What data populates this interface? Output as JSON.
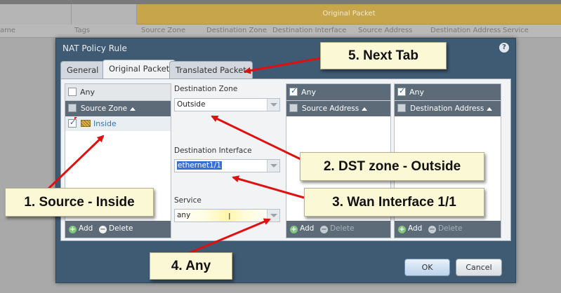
{
  "background": {
    "group_header": "Original Packet",
    "columns": [
      "ame",
      "Tags",
      "Source Zone",
      "Destination Zone",
      "Destination Interface",
      "Source Address",
      "Destination Address",
      "Service"
    ]
  },
  "dialog": {
    "title": "NAT Policy Rule",
    "help_icon": "?",
    "tabs": [
      {
        "label": "General",
        "active": false
      },
      {
        "label": "Original Packet",
        "active": true
      },
      {
        "label": "Translated Packet",
        "active": false
      }
    ],
    "source_zone_panel": {
      "any_label": "Any",
      "any_checked": false,
      "header": "Source Zone",
      "rows": [
        {
          "label": "Inside",
          "checked": true
        }
      ],
      "add_label": "Add",
      "delete_label": "Delete"
    },
    "destination_zone": {
      "label": "Destination Zone",
      "value": "Outside"
    },
    "destination_interface": {
      "label": "Destination Interface",
      "value": "ethernet1/1"
    },
    "service": {
      "label": "Service",
      "value": "any"
    },
    "source_address_panel": {
      "any_label": "Any",
      "any_checked": true,
      "header": "Source Address",
      "add_label": "Add",
      "delete_label": "Delete"
    },
    "destination_address_panel": {
      "any_label": "Any",
      "any_checked": true,
      "header": "Destination Address",
      "add_label": "Add",
      "delete_label": "Delete"
    },
    "ok_label": "OK",
    "cancel_label": "Cancel"
  },
  "annotations": {
    "c1": "1. Source - Inside",
    "c2": "2. DST zone - Outside",
    "c3": "3. Wan Interface 1/1",
    "c4": "4. Any",
    "c5": "5. Next Tab",
    "arrow_color": "#e01010"
  }
}
